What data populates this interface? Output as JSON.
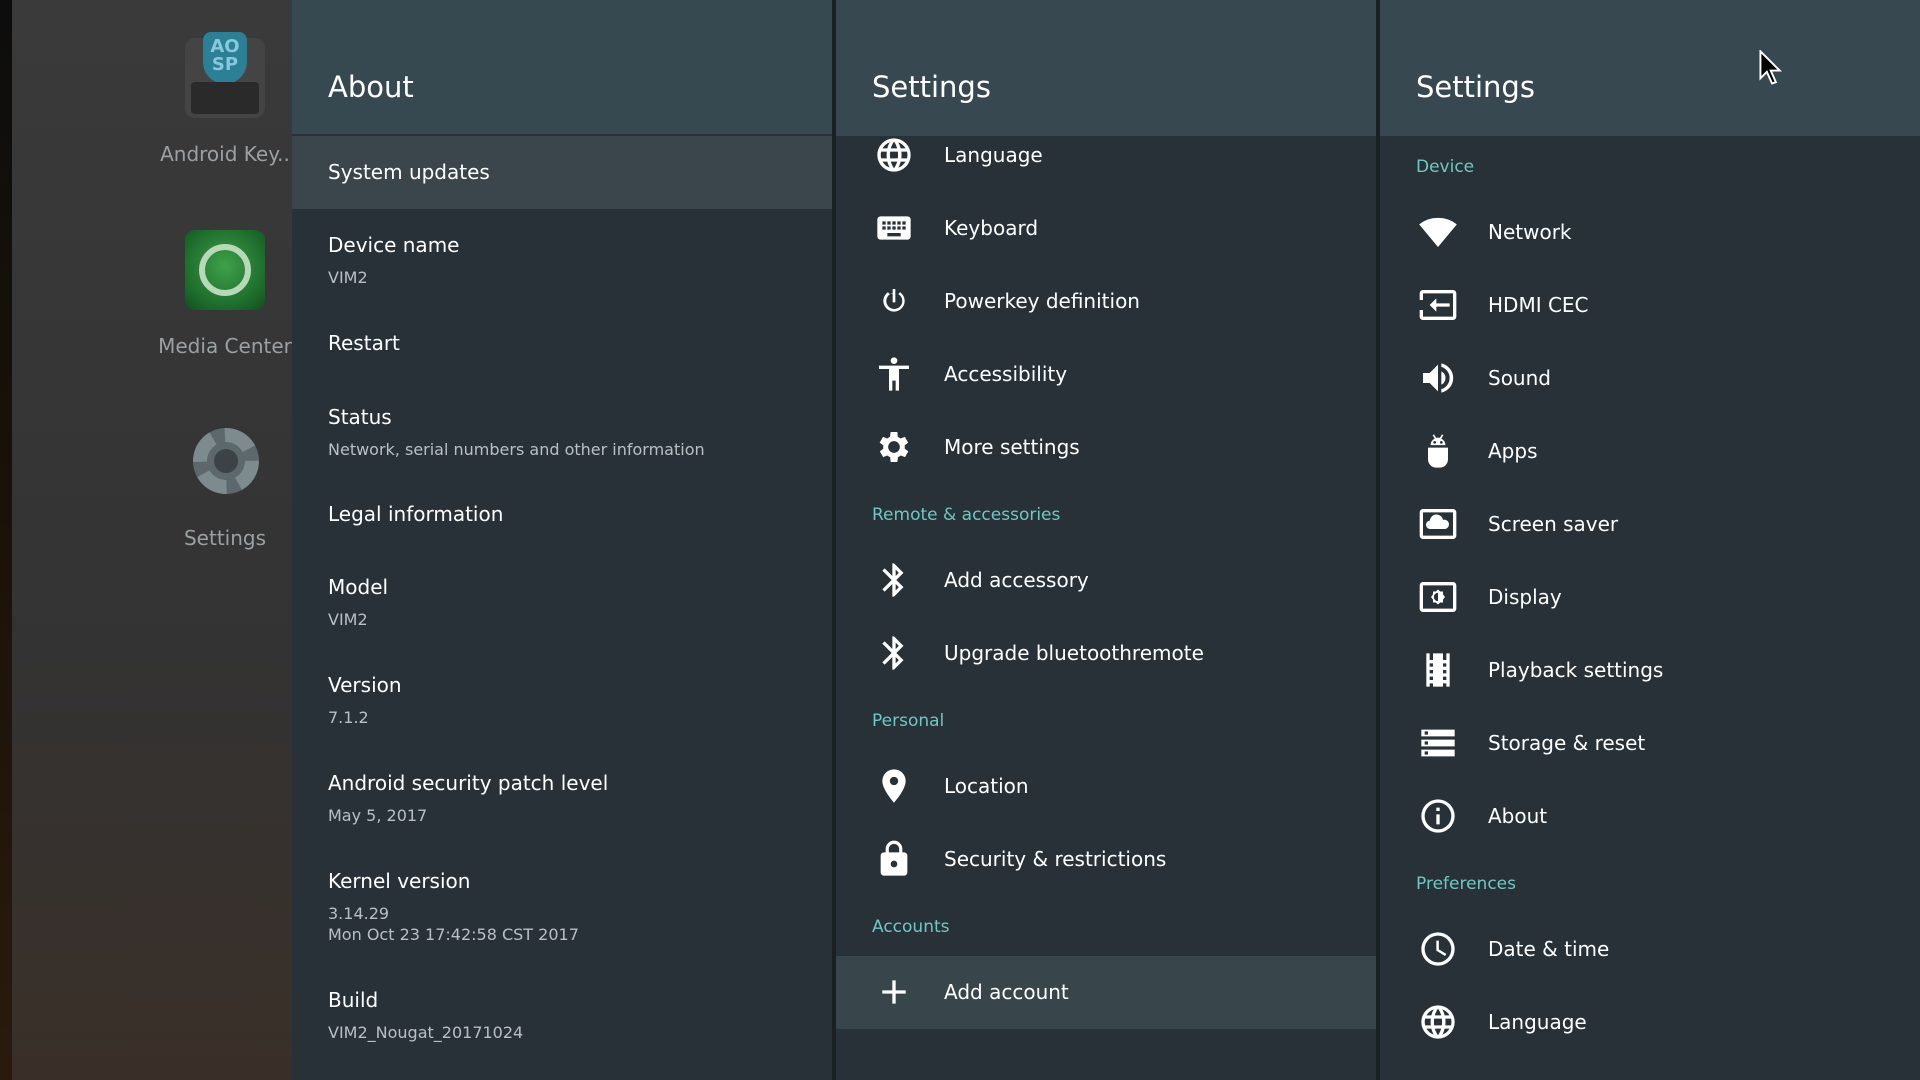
{
  "launcher": {
    "apps": [
      {
        "label": "Android Key..",
        "icon": "aosp-keyboard-icon",
        "badge": "AO SP"
      },
      {
        "label": "Media Center",
        "icon": "media-center-icon"
      },
      {
        "label": "Settings",
        "icon": "settings-gear-icon"
      }
    ]
  },
  "about": {
    "title": "About",
    "items": [
      {
        "title": "System updates",
        "subtitle": ""
      },
      {
        "title": "Device name",
        "subtitle": "VIM2"
      },
      {
        "title": "Restart",
        "subtitle": ""
      },
      {
        "title": "Status",
        "subtitle": "Network, serial numbers and other information"
      },
      {
        "title": "Legal information",
        "subtitle": ""
      },
      {
        "title": "Model",
        "subtitle": "VIM2"
      },
      {
        "title": "Version",
        "subtitle": "7.1.2"
      },
      {
        "title": "Android security patch level",
        "subtitle": "May 5, 2017"
      },
      {
        "title": "Kernel version",
        "subtitle": "3.14.29",
        "subtitle2": "Mon Oct 23 17:42:58 CST 2017"
      },
      {
        "title": "Build",
        "subtitle": "VIM2_Nougat_20171024"
      }
    ]
  },
  "settings_mid": {
    "title": "Settings",
    "rows": [
      {
        "label": "Language",
        "icon": "globe-icon"
      },
      {
        "label": "Keyboard",
        "icon": "keyboard-icon"
      },
      {
        "label": "Powerkey definition",
        "icon": "power-icon"
      },
      {
        "label": "Accessibility",
        "icon": "accessibility-icon"
      },
      {
        "label": "More settings",
        "icon": "gear-icon"
      }
    ],
    "section_remote": "Remote & accessories",
    "remote_rows": [
      {
        "label": "Add accessory",
        "icon": "bluetooth-icon"
      },
      {
        "label": "Upgrade bluetoothremote",
        "icon": "bluetooth-icon"
      }
    ],
    "section_personal": "Personal",
    "personal_rows": [
      {
        "label": "Location",
        "icon": "location-pin-icon"
      },
      {
        "label": "Security & restrictions",
        "icon": "lock-icon"
      }
    ],
    "section_accounts": "Accounts",
    "account_rows": [
      {
        "label": "Add account",
        "icon": "plus-icon"
      }
    ]
  },
  "settings_right": {
    "title": "Settings",
    "section_device": "Device",
    "device_rows": [
      {
        "label": "Network",
        "icon": "wifi-icon"
      },
      {
        "label": "HDMI CEC",
        "icon": "hdmi-input-icon"
      },
      {
        "label": "Sound",
        "icon": "speaker-icon"
      },
      {
        "label": "Apps",
        "icon": "android-icon"
      },
      {
        "label": "Screen saver",
        "icon": "screensaver-icon"
      },
      {
        "label": "Display",
        "icon": "display-brightness-icon"
      },
      {
        "label": "Playback settings",
        "icon": "film-icon"
      },
      {
        "label": "Storage & reset",
        "icon": "storage-icon"
      },
      {
        "label": "About",
        "icon": "info-icon"
      }
    ],
    "section_preferences": "Preferences",
    "pref_rows": [
      {
        "label": "Date & time",
        "icon": "clock-icon"
      },
      {
        "label": "Language",
        "icon": "globe-icon"
      }
    ]
  },
  "colors": {
    "accent": "#70c7c3",
    "header": "#374850",
    "panel": "#283137",
    "selected": "#3a464c"
  }
}
